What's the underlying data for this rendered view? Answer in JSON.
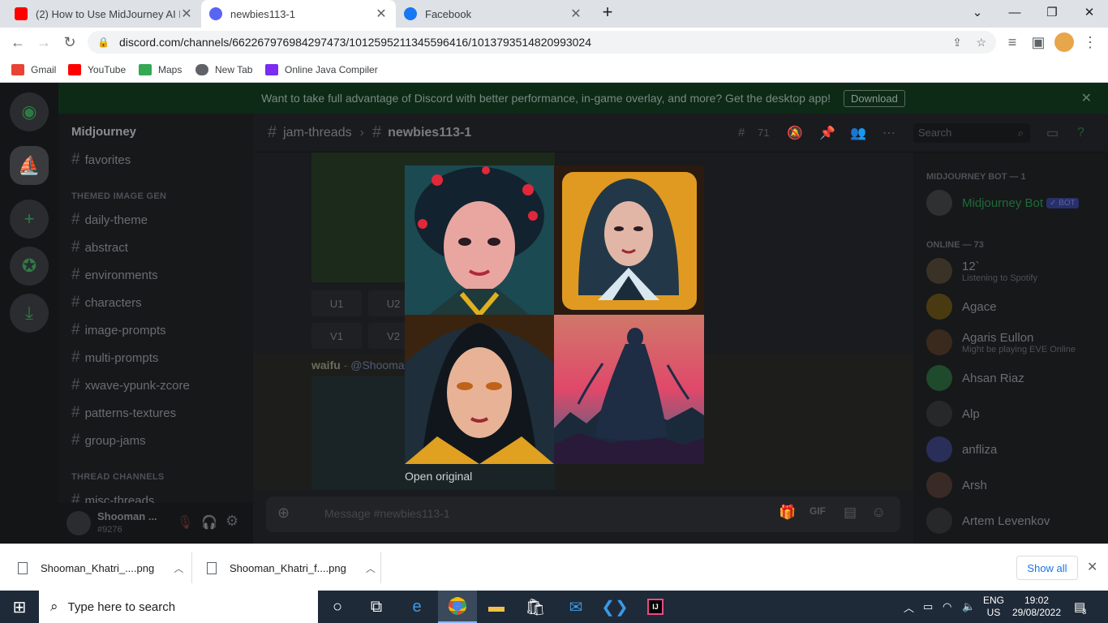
{
  "browser": {
    "tabs": [
      {
        "title": "(2) How to Use MidJourney AI Im",
        "favicon": "youtube-icon"
      },
      {
        "title": "newbies113-1",
        "favicon": "discord-icon"
      },
      {
        "title": "Facebook",
        "favicon": "facebook-icon"
      }
    ],
    "url": "discord.com/channels/662267976984297473/1012595211345596416/1013793514820993024",
    "bookmarks": [
      "Gmail",
      "YouTube",
      "Maps",
      "New Tab",
      "Online Java Compiler"
    ]
  },
  "discord": {
    "banner_text": "Want to take full advantage of Discord with better performance, in-game overlay, and more? Get the desktop app!",
    "banner_button": "Download",
    "server_name": "Midjourney",
    "channels_top": [
      "favorites"
    ],
    "category_themed": "THEMED IMAGE GEN",
    "channels_themed": [
      "daily-theme",
      "abstract",
      "environments",
      "characters",
      "image-prompts",
      "multi-prompts",
      "xwave-ypunk-zcore",
      "patterns-textures",
      "group-jams"
    ],
    "category_threads": "THREAD CHANNELS",
    "channels_threads": [
      "misc-threads"
    ],
    "user": {
      "name": "Shooman ...",
      "tag": "#9276"
    },
    "breadcrumb_parent": "jam-threads",
    "breadcrumb_current": "newbies113-1",
    "thread_count": "71",
    "search_placeholder": "Search",
    "upscale_buttons": [
      "U1",
      "U2"
    ],
    "variation_buttons": [
      "V1",
      "V2"
    ],
    "message_author": "waifu",
    "message_mention": "@Shooma",
    "message_placeholder": "Message #newbies113-1",
    "members": {
      "bot_category": "MIDJOURNEY BOT — 1",
      "bot_name": "Midjourney Bot",
      "bot_badge": "✓ BOT",
      "online_category": "ONLINE — 73",
      "list": [
        {
          "name": "12`",
          "status": "Listening to Spotify"
        },
        {
          "name": "Agace",
          "status": ""
        },
        {
          "name": "Agaris Eullon",
          "status": "Might be playing EVE Online"
        },
        {
          "name": "Ahsan Riaz",
          "status": ""
        },
        {
          "name": "Alp",
          "status": ""
        },
        {
          "name": "anfliza",
          "status": ""
        },
        {
          "name": "Arsh",
          "status": ""
        },
        {
          "name": "Artem Levenkov",
          "status": ""
        }
      ]
    }
  },
  "viewer": {
    "open_original": "Open original"
  },
  "downloads": {
    "items": [
      "Shooman_Khatri_....png",
      "Shooman_Khatri_f....png"
    ],
    "show_all": "Show all"
  },
  "taskbar": {
    "search_placeholder": "Type here to search",
    "lang_top": "ENG",
    "lang_bottom": "US",
    "time": "19:02",
    "date": "29/08/2022",
    "notifications": "3"
  }
}
